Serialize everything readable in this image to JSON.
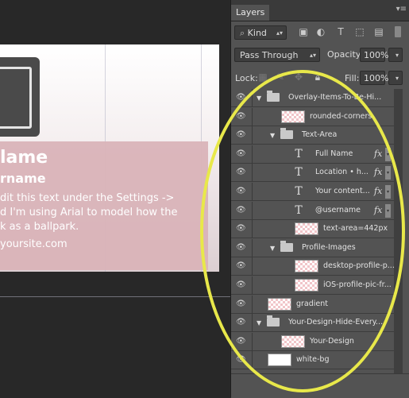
{
  "canvas": {
    "name_text": "lame",
    "username_text": "rname",
    "bio_lines": [
      "dit this text under the Settings ->",
      "d I'm using Arial to model how the",
      "k as a ballpark."
    ],
    "url_text": "yoursite.com"
  },
  "panel": {
    "tab_label": "Layers",
    "filter_kind": "Kind",
    "blend_mode": "Pass Through",
    "opacity_label": "Opacity:",
    "opacity_value": "100%",
    "lock_label": "Lock:",
    "fill_label": "Fill:",
    "fill_value": "100%"
  },
  "layers": [
    {
      "name": "Overlay-Items-To-Be-Hi...",
      "kind": "group",
      "indent": 0,
      "expanded": true,
      "fx": false
    },
    {
      "name": "rounded-corners",
      "kind": "pixel",
      "indent": 1,
      "fx": false
    },
    {
      "name": "Text-Area",
      "kind": "group",
      "indent": 1,
      "expanded": true,
      "fx": false
    },
    {
      "name": "Full Name",
      "kind": "text",
      "indent": 2,
      "fx": true
    },
    {
      "name": "Location  •  h...",
      "kind": "text",
      "indent": 2,
      "fx": true
    },
    {
      "name": "Your content...",
      "kind": "text",
      "indent": 2,
      "fx": true
    },
    {
      "name": "@username",
      "kind": "text",
      "indent": 2,
      "fx": true
    },
    {
      "name": "text-area=442px",
      "kind": "pixel",
      "indent": 2,
      "fx": false
    },
    {
      "name": "Profile-Images",
      "kind": "group",
      "indent": 1,
      "expanded": true,
      "fx": false
    },
    {
      "name": "desktop-profile-p...",
      "kind": "pixel",
      "indent": 2,
      "fx": false
    },
    {
      "name": "iOS-profile-pic-fr...",
      "kind": "pixel",
      "indent": 2,
      "fx": false
    },
    {
      "name": "gradient",
      "kind": "pixel",
      "indent": 0,
      "fx": false
    },
    {
      "name": "Your-Design-Hide-Every...",
      "kind": "group",
      "indent": 0,
      "expanded": true,
      "fx": false
    },
    {
      "name": "Your-Design",
      "kind": "pixel",
      "indent": 1,
      "fx": false
    },
    {
      "name": "white-bg",
      "kind": "white",
      "indent": 0,
      "fx": false
    }
  ],
  "colors": {
    "highlight": "#e8e84a",
    "panel": "#535353",
    "canvas_bg": "#282828"
  },
  "icons": {
    "eye": "eye-icon",
    "folder": "folder-icon",
    "text_layer": "text-layer-icon",
    "fx": "fx-icon"
  }
}
